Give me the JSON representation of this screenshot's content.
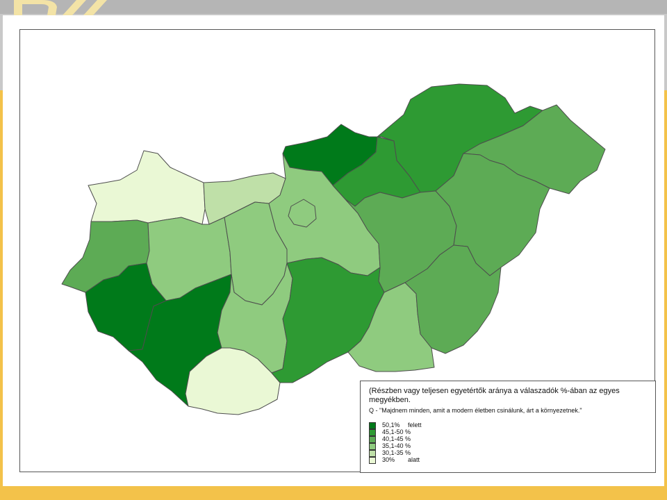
{
  "legend": {
    "title": "(Részben vagy teljesen egyetértők aránya a válaszadók %-ában az egyes megyékben.",
    "question": "Q - \"Majdnem minden, amit a modern életben csinálunk, árt a környezetnek.\"",
    "items": [
      {
        "range": "50,1%",
        "suffix": "felett",
        "color": "#007a1a"
      },
      {
        "range": "45,1-50 %",
        "suffix": "",
        "color": "#2e9a33"
      },
      {
        "range": "40,1-45 %",
        "suffix": "",
        "color": "#5dab55"
      },
      {
        "range": "35,1-40 %",
        "suffix": "",
        "color": "#8fcb7f"
      },
      {
        "range": "30,1-35 %",
        "suffix": "",
        "color": "#bfe0a8"
      },
      {
        "range": "30%",
        "suffix": "alatt",
        "color": "#eaf8d5"
      }
    ]
  },
  "map": {
    "stroke_color": "#4d4d4d",
    "counties": [
      {
        "name": "Győr-Moson-Sopron",
        "class": "30% alatt",
        "color": "#eaf8d5"
      },
      {
        "name": "Komárom-Esztergom",
        "class": "30,1-35 %",
        "color": "#bfe0a8"
      },
      {
        "name": "Nógrád",
        "class": "50,1% felett",
        "color": "#007a1a"
      },
      {
        "name": "Borsod-Abaúj-Zemplén",
        "class": "45,1-50 %",
        "color": "#2e9a33"
      },
      {
        "name": "Szabolcs-Szatmár-Bereg",
        "class": "40,1-45 %",
        "color": "#5dab55"
      },
      {
        "name": "Vas",
        "class": "40,1-45 %",
        "color": "#5dab55"
      },
      {
        "name": "Veszprém",
        "class": "35,1-40 %",
        "color": "#8fcb7f"
      },
      {
        "name": "Fejér",
        "class": "35,1-40 %",
        "color": "#8fcb7f"
      },
      {
        "name": "Pest",
        "class": "35,1-40 %",
        "color": "#8fcb7f"
      },
      {
        "name": "Budapest",
        "class": "35,1-40 %",
        "color": "#8fcb7f"
      },
      {
        "name": "Heves",
        "class": "45,1-50 %",
        "color": "#2e9a33"
      },
      {
        "name": "Jász-Nagykun-Szolnok",
        "class": "40,1-45 %",
        "color": "#5dab55"
      },
      {
        "name": "Hajdú-Bihar",
        "class": "40,1-45 %",
        "color": "#5dab55"
      },
      {
        "name": "Zala",
        "class": "50,1% felett",
        "color": "#007a1a"
      },
      {
        "name": "Somogy",
        "class": "50,1% felett",
        "color": "#007a1a"
      },
      {
        "name": "Tolna",
        "class": "35,1-40 %",
        "color": "#8fcb7f"
      },
      {
        "name": "Baranya",
        "class": "30% alatt",
        "color": "#eaf8d5"
      },
      {
        "name": "Bács-Kiskun",
        "class": "45,1-50 %",
        "color": "#2e9a33"
      },
      {
        "name": "Csongrád",
        "class": "35,1-40 %",
        "color": "#8fcb7f"
      },
      {
        "name": "Békés",
        "class": "40,1-45 %",
        "color": "#5dab55"
      }
    ]
  }
}
